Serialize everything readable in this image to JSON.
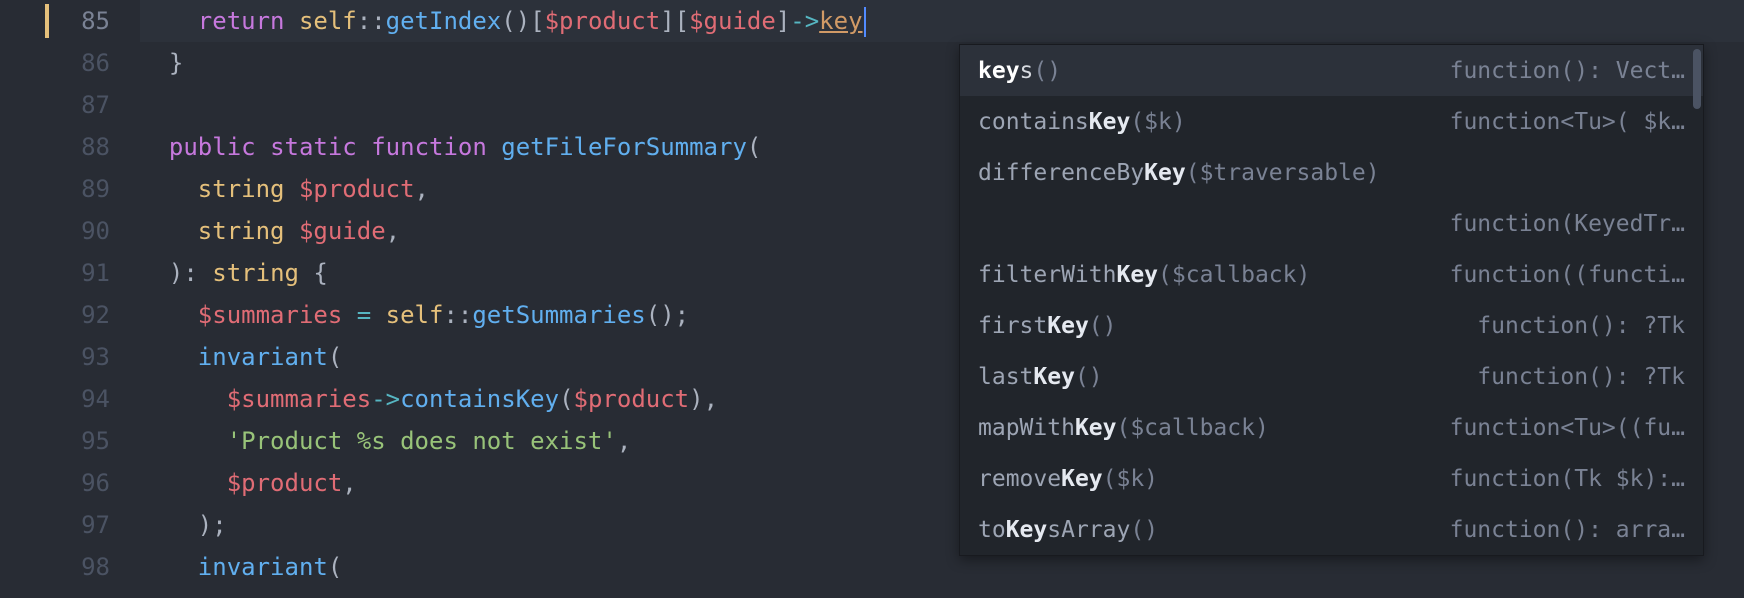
{
  "lines": [
    {
      "num": 85,
      "current": true
    },
    {
      "num": 86
    },
    {
      "num": 87
    },
    {
      "num": 88
    },
    {
      "num": 89
    },
    {
      "num": 90
    },
    {
      "num": 91
    },
    {
      "num": 92
    },
    {
      "num": 93
    },
    {
      "num": 94
    },
    {
      "num": 95
    },
    {
      "num": 96
    },
    {
      "num": 97
    },
    {
      "num": 98
    }
  ],
  "code": {
    "l85": {
      "kw_return": "return",
      "self": "self",
      "scope": "::",
      "fn": "getIndex",
      "call": "()",
      "ob1": "[",
      "v1": "$product",
      "cb1": "]",
      "ob2": "[",
      "v2": "$guide",
      "cb2": "]",
      "arrow": "->",
      "typed": "key"
    },
    "l86": {
      "brace": "}"
    },
    "l88": {
      "kw_public": "public",
      "kw_static": "static",
      "kw_function": "function",
      "fn": "getFileForSummary",
      "paren": "("
    },
    "l89": {
      "ty": "string",
      "var": "$product",
      "comma": ","
    },
    "l90": {
      "ty": "string",
      "var": "$guide",
      "comma": ","
    },
    "l91": {
      "paren": ")",
      "colon": ":",
      "ty": "string",
      "brace": "{"
    },
    "l92": {
      "var": "$summaries",
      "eq": "=",
      "self": "self",
      "scope": "::",
      "fn": "getSummaries",
      "call": "();"
    },
    "l93": {
      "fn": "invariant",
      "paren": "("
    },
    "l94": {
      "var": "$summaries",
      "arrow": "->",
      "fn": "containsKey",
      "paren_o": "(",
      "arg": "$product",
      "paren_c": ")",
      "comma": ","
    },
    "l95": {
      "str": "'Product %s does not exist'",
      "comma": ","
    },
    "l96": {
      "var": "$product",
      "comma": ","
    },
    "l97": {
      "paren": ");"
    },
    "l98": {
      "fn": "invariant",
      "paren": "("
    }
  },
  "autocomplete": {
    "items": [
      {
        "pre": "",
        "match": "key",
        "post": "s",
        "params": "()",
        "hint": "function(): Vect…",
        "selected": true
      },
      {
        "pre": "contains",
        "match": "Key",
        "post": "",
        "params": "($k)",
        "hint": "function<Tu>( $k…"
      },
      {
        "pre": "differenceBy",
        "match": "Key",
        "post": "",
        "params": "($traversable)",
        "hint": ""
      },
      {
        "pre": "",
        "match": "",
        "post": "",
        "params": "",
        "hint": "function(KeyedTr…"
      },
      {
        "pre": "filterWith",
        "match": "Key",
        "post": "",
        "params": "($callback)",
        "hint": "function((functi…"
      },
      {
        "pre": "first",
        "match": "Key",
        "post": "",
        "params": "()",
        "hint": "function(): ?Tk"
      },
      {
        "pre": "last",
        "match": "Key",
        "post": "",
        "params": "()",
        "hint": "function(): ?Tk"
      },
      {
        "pre": "mapWith",
        "match": "Key",
        "post": "",
        "params": "($callback)",
        "hint": "function<Tu>((fu…"
      },
      {
        "pre": "remove",
        "match": "Key",
        "post": "",
        "params": "($k)",
        "hint": "function(Tk $k):…"
      },
      {
        "pre": "to",
        "match": "Key",
        "post": "sArray",
        "params": "()",
        "hint": "function(): arra…"
      }
    ]
  }
}
